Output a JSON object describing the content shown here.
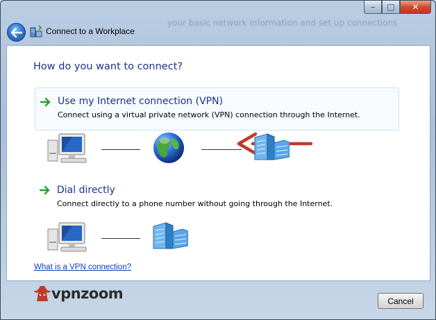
{
  "window": {
    "title": "Connect to a Workplace",
    "background_text": "your basic network information and set up connections"
  },
  "caption_buttons": {
    "minimize": "–",
    "maximize": "□",
    "close": "✕"
  },
  "main": {
    "heading": "How do you want to connect?",
    "options": [
      {
        "title": "Use my Internet connection (VPN)",
        "description": "Connect using a virtual private network (VPN) connection through the Internet.",
        "icon": "green-arrow-icon",
        "highlighted": true
      },
      {
        "title": "Dial directly",
        "description": "Connect directly to a phone number without going through the Internet.",
        "icon": "green-arrow-icon",
        "highlighted": false
      }
    ],
    "diagrams": [
      {
        "nodes": [
          "computer-icon",
          "globe-icon",
          "office-building-icon"
        ]
      },
      {
        "nodes": [
          "computer-icon",
          "office-building-icon"
        ]
      }
    ],
    "help_link": "What is a VPN connection?"
  },
  "footer": {
    "logo_text": "vpnzoom",
    "cancel_label": "Cancel"
  },
  "colors": {
    "heading": "#1e3287",
    "link": "#0645ad",
    "annotation_arrow": "#c0392b",
    "option_arrow": "#2e9e2e"
  }
}
